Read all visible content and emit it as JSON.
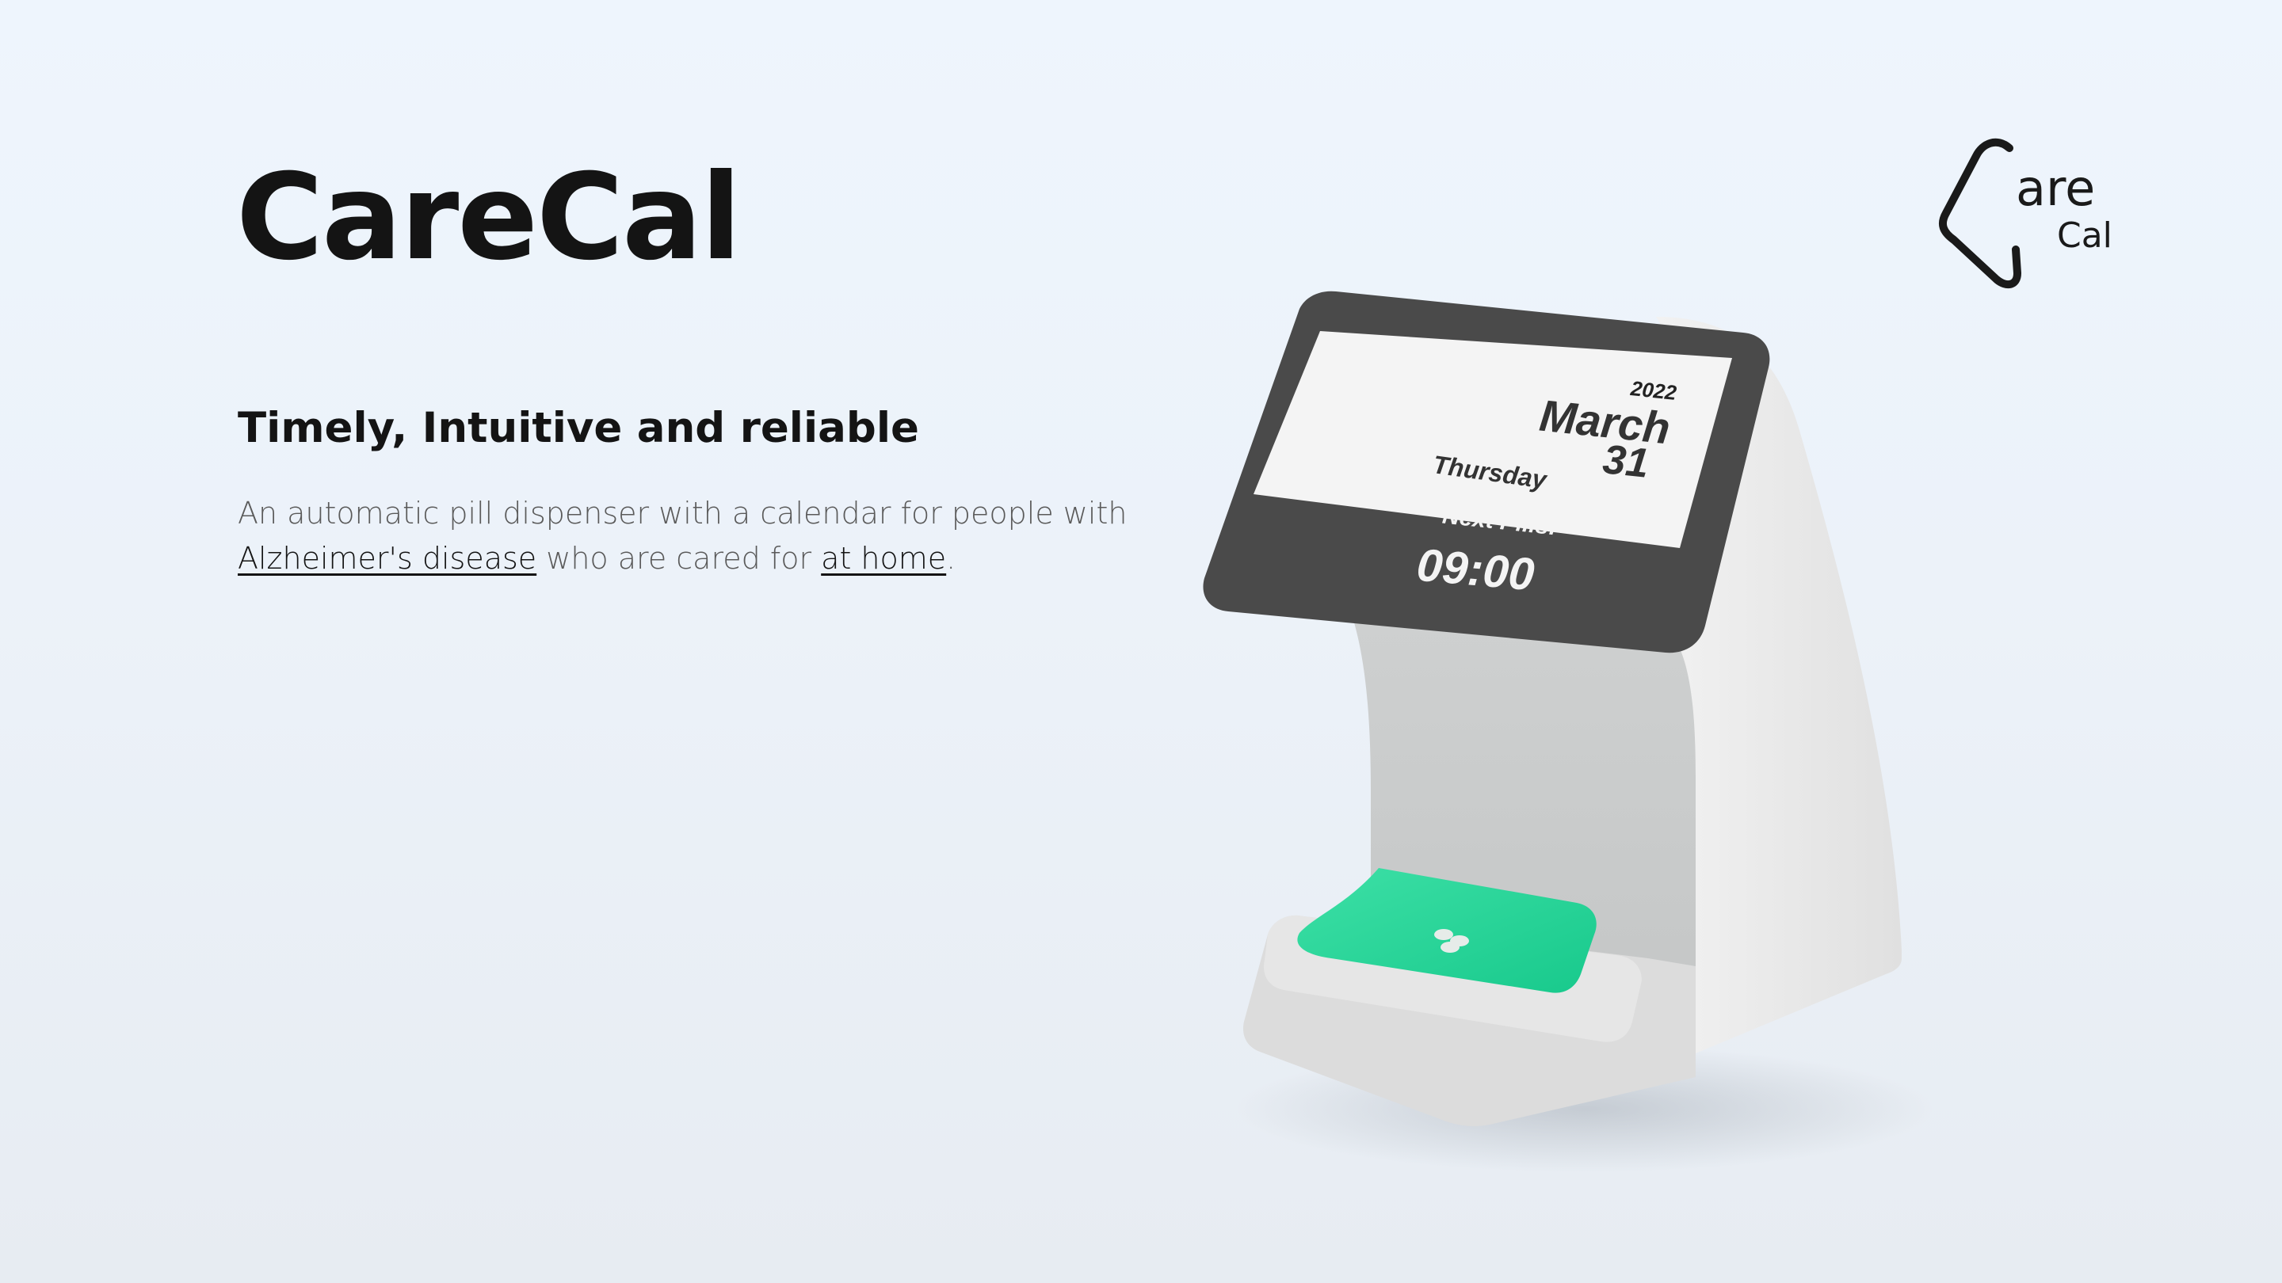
{
  "hero": {
    "title": "CareCal",
    "tagline": "Timely, Intuitive and reliable",
    "description": {
      "part1": "An automatic pill dispenser with a calendar for people with ",
      "link1": "Alzheimer's disease",
      "part2": " who are cared for ",
      "link2": "at home",
      "part3": "."
    }
  },
  "logo": {
    "line1": "are",
    "line2": "Cal",
    "icon": "carecal-logo-icon"
  },
  "device_screen": {
    "year": "2022",
    "month": "March",
    "day": "31",
    "weekday": "Thursday",
    "next_label": "Next Pills:",
    "next_time": "09:00"
  },
  "colors": {
    "background": "#eef5fd",
    "title": "#141414",
    "body_text": "#5a5a5a",
    "device_body": "#e4e4e4",
    "screen_bezel": "#4a4a4a",
    "tray_glow": "#2fd59a"
  }
}
